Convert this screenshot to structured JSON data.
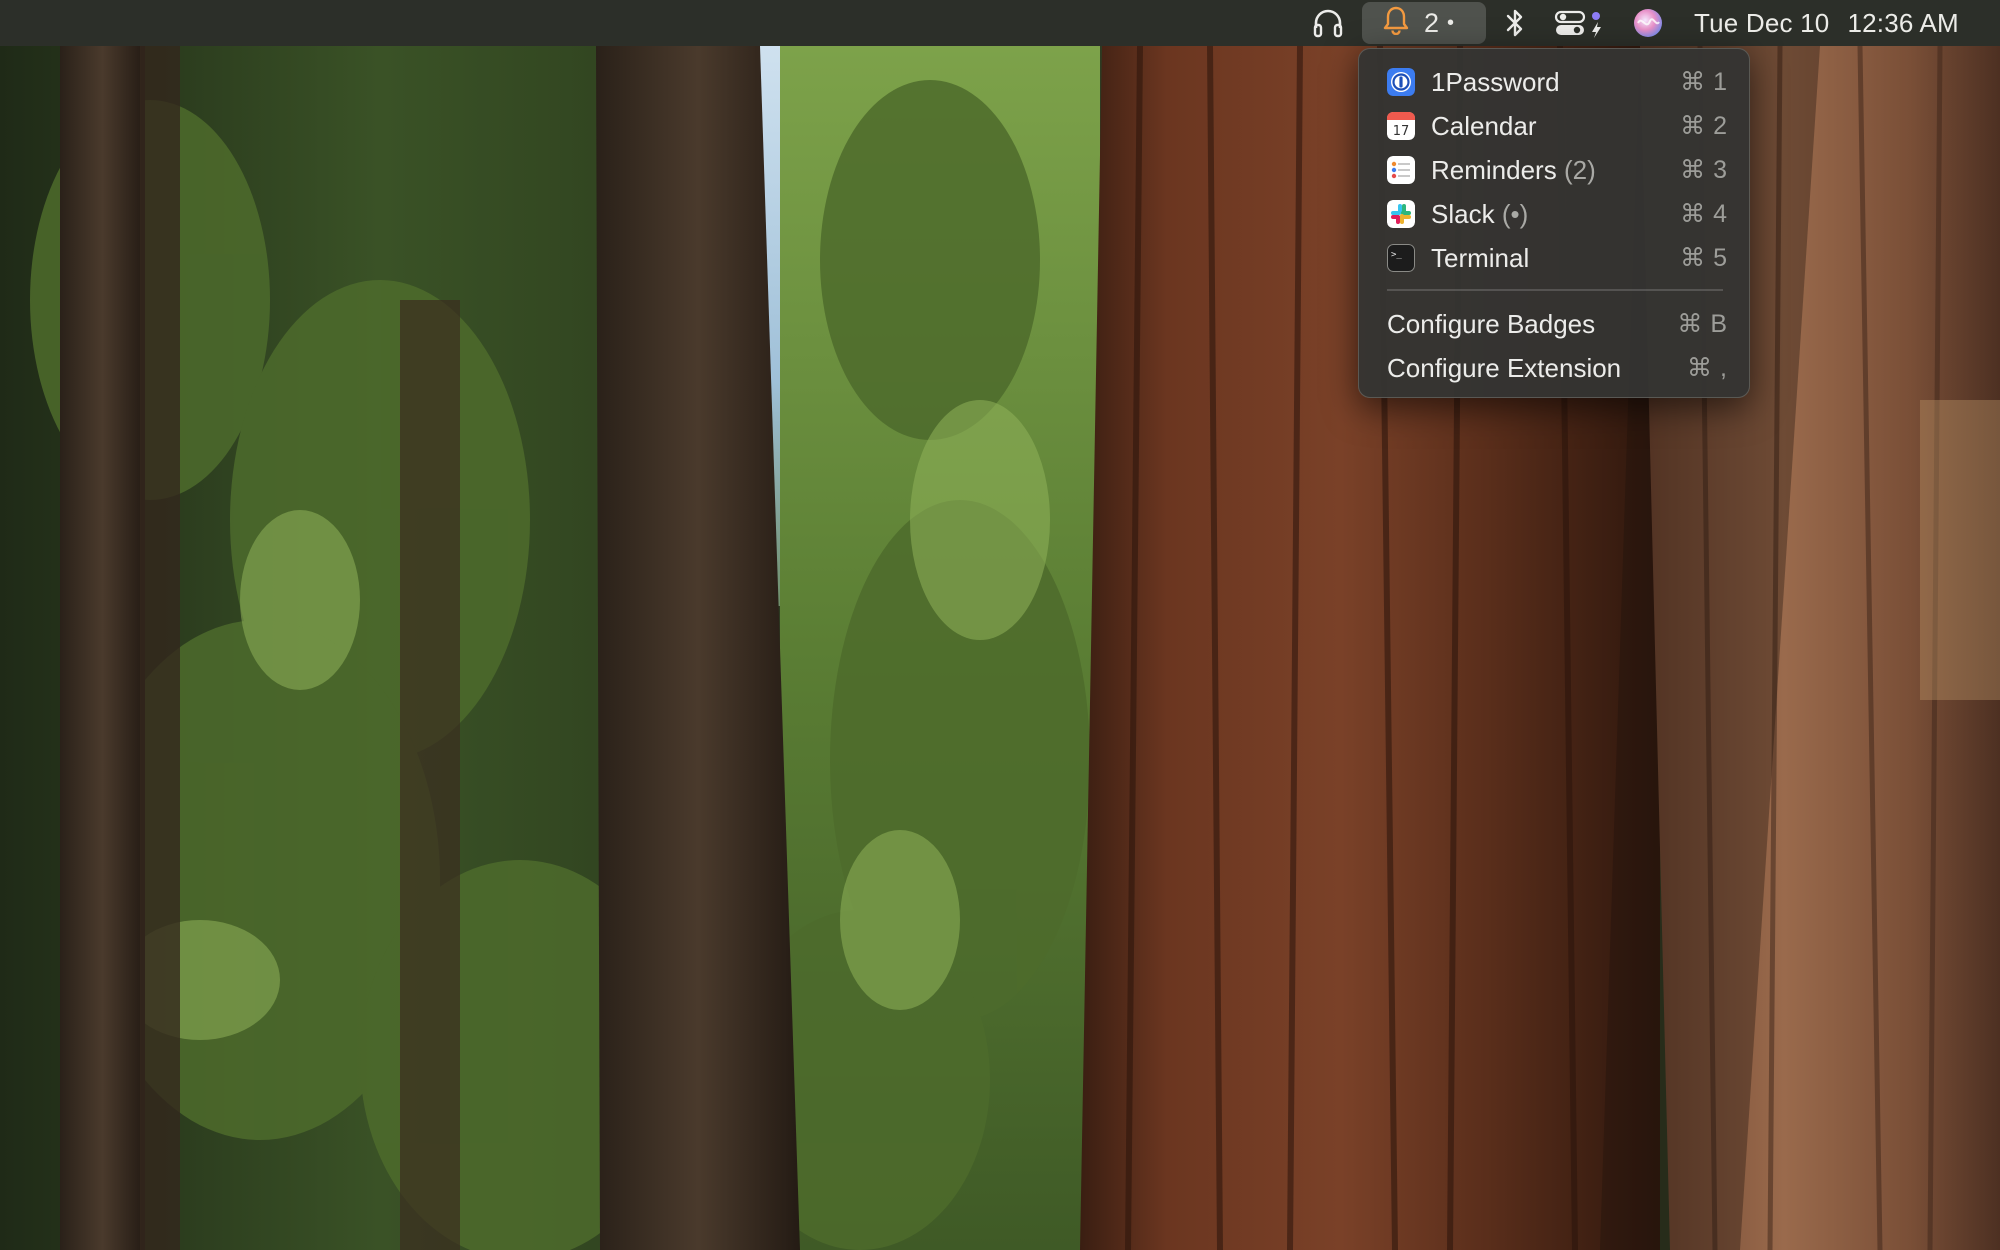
{
  "menubar": {
    "icons": {
      "headphones": "headphones-icon",
      "badges_bell": "bell-icon",
      "bluetooth": "bluetooth-icon",
      "control_center": "control-center-icon",
      "siri": "siri-icon"
    },
    "badge_count": "2",
    "badge_dot": "•",
    "date": "Tue Dec 10",
    "time": "12:36 AM"
  },
  "menu": {
    "shortcut_symbol": "⌘",
    "apps": [
      {
        "name": "1Password",
        "badge": "",
        "key": "1",
        "icon": "1password-icon",
        "color": "#3c7cf0"
      },
      {
        "name": "Calendar",
        "badge": "",
        "key": "2",
        "icon": "calendar-icon",
        "icon_text": "17",
        "color": "#f05a4e"
      },
      {
        "name": "Reminders",
        "badge": "(2)",
        "key": "3",
        "icon": "reminders-icon",
        "color": "#ffffff"
      },
      {
        "name": "Slack",
        "badge": "(•)",
        "key": "4",
        "icon": "slack-icon",
        "color": "#4a154b"
      },
      {
        "name": "Terminal",
        "badge": "",
        "key": "5",
        "icon": "terminal-icon",
        "icon_text": ">_",
        "color": "#1c1c1c"
      }
    ],
    "actions": [
      {
        "label": "Configure Badges",
        "key": "B"
      },
      {
        "label": "Configure Extension",
        "key": ","
      }
    ]
  }
}
